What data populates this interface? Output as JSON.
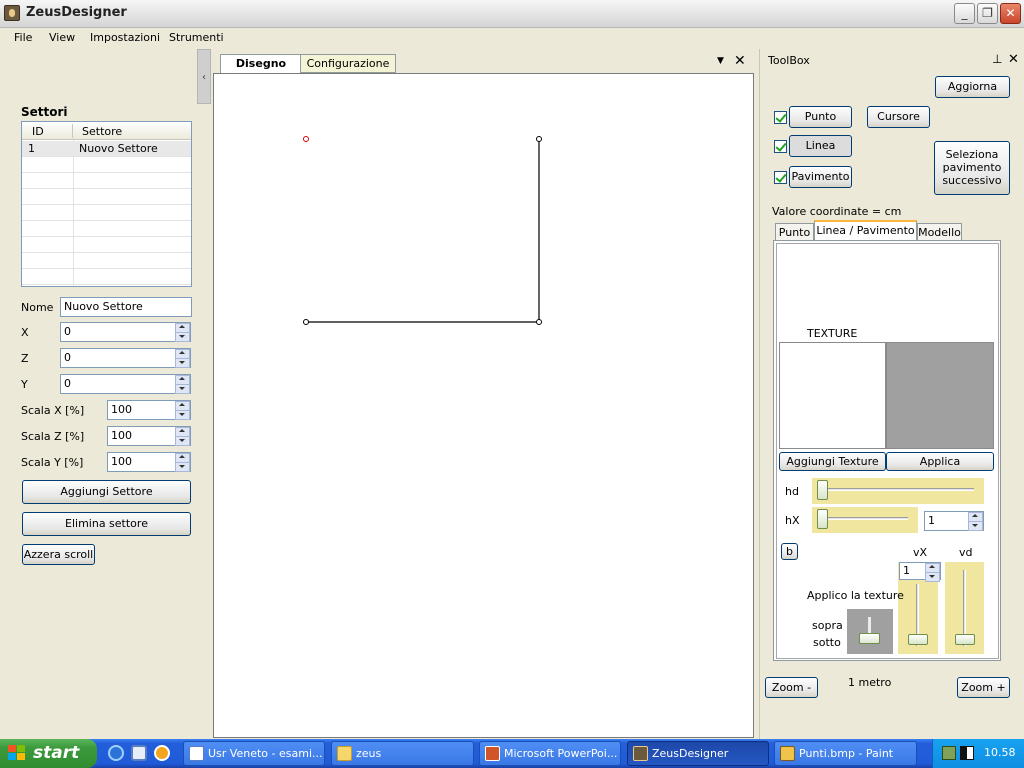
{
  "window": {
    "title": "ZeusDesigner",
    "min_icon": "minimize-icon",
    "max_icon": "restore-icon",
    "close_icon": "close-icon"
  },
  "menu": [
    "File",
    "View",
    "Impostazioni",
    "Strumenti"
  ],
  "left_panel": {
    "section_label": "Settori",
    "table": {
      "headers": [
        "ID",
        "Settore"
      ],
      "rows": [
        [
          "1",
          "Nuovo Settore"
        ]
      ]
    },
    "fields": {
      "nome_label": "Nome",
      "nome_value": "Nuovo Settore",
      "x_label": "X",
      "x_value": "0",
      "z_label": "Z",
      "z_value": "0",
      "y_label": "Y",
      "y_value": "0",
      "scalax_label": "Scala X [%]",
      "scalax_value": "100",
      "scalaz_label": "Scala Z [%]",
      "scalaz_value": "100",
      "scalay_label": "Scala Y [%]",
      "scalay_value": "100"
    },
    "buttons": {
      "aggiungi": "Aggiungi Settore",
      "elimina": "Elimina settore",
      "azzera": "Azzera scroll"
    },
    "collapse_icon": "chevron-left-icon"
  },
  "document": {
    "tabs": [
      "Disegno",
      "Configurazione"
    ],
    "active_tab": "Disegno",
    "dropdown_icon": "chevron-down-icon",
    "close_icon": "close-icon"
  },
  "toolbox": {
    "title": "ToolBox",
    "pin_icon": "pin-icon",
    "close_icon": "close-icon",
    "aggiorna": "Aggiorna",
    "punto": "Punto",
    "punto_checked": true,
    "cursore": "Cursore",
    "linea": "Linea",
    "linea_checked": true,
    "pavimento": "Pavimento",
    "pavimento_checked": true,
    "seleziona": [
      "Seleziona",
      "pavimento",
      "successivo"
    ],
    "coord_label": "Valore coordinate = cm",
    "tabs": [
      "Punto",
      "Linea / Pavimento",
      "Modello"
    ],
    "active_tab": "Linea / Pavimento",
    "texture_label": "TEXTURE",
    "aggiungi_texture": "Aggiungi Texture",
    "applica": "Applica",
    "hd_label": "hd",
    "hx_label": "hX",
    "hx_value": "1",
    "b_button": "b",
    "vx_label": "vX",
    "vd_label": "vd",
    "vx_value": "1",
    "applico_label": "Applico la texture",
    "sopra_label": "sopra",
    "sotto_label": "sotto",
    "zoom_minus": "Zoom -",
    "zoom_plus": "Zoom +",
    "scale_label": "1 metro",
    "colors": {
      "slider_bg": "#f0e6a0",
      "texture_preview": "#a0a0a0"
    }
  },
  "taskbar": {
    "start": "start",
    "tasks": [
      {
        "label": "Usr Veneto - esami...",
        "icon": "ie-window-icon",
        "active": false
      },
      {
        "label": "zeus",
        "icon": "folder-icon",
        "active": false
      },
      {
        "label": "Microsoft PowerPoi...",
        "icon": "powerpoint-icon",
        "active": false
      },
      {
        "label": "ZeusDesigner",
        "icon": "zeus-app-icon",
        "active": true
      },
      {
        "label": "Punti.bmp - Paint",
        "icon": "paint-icon",
        "active": false
      }
    ],
    "clock": "10.58"
  }
}
